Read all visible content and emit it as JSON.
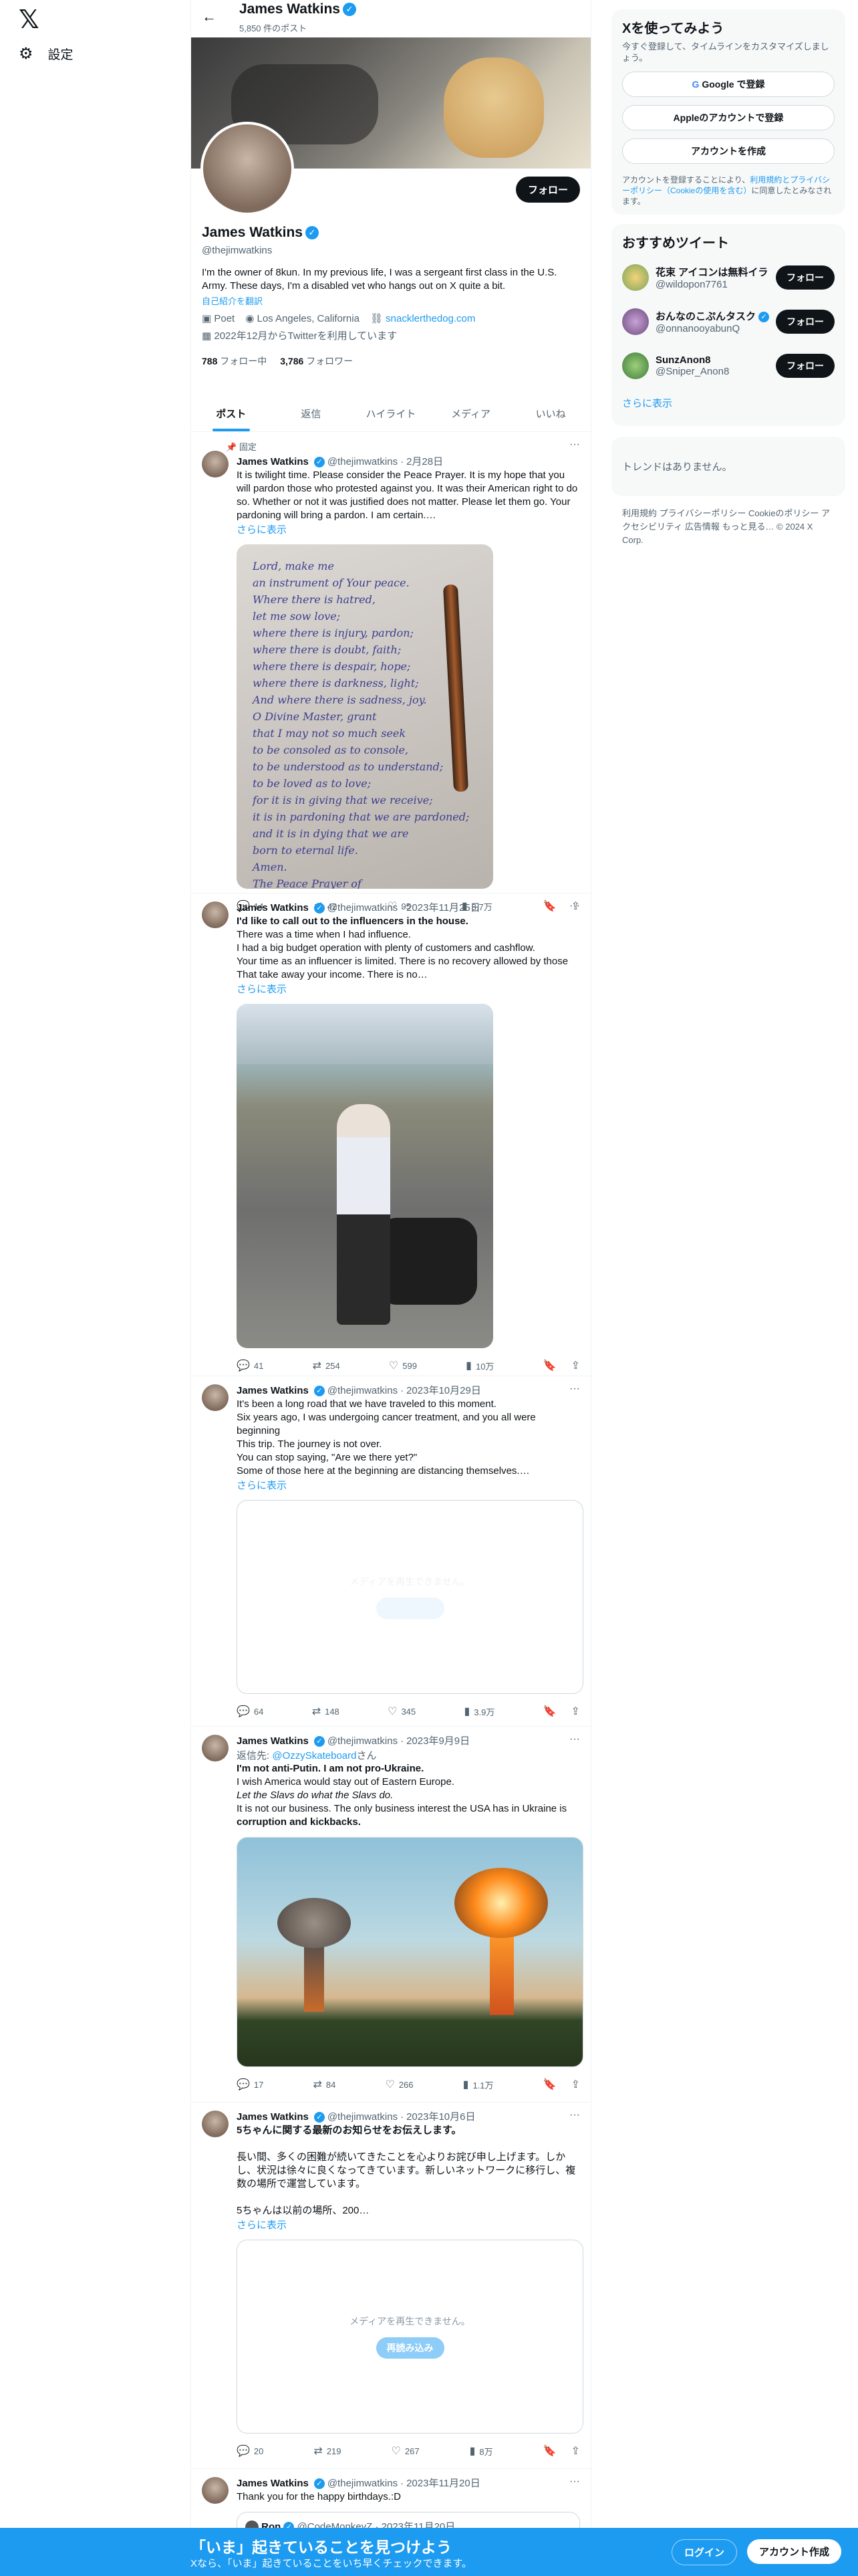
{
  "nav": {
    "logo": "𝕏",
    "settings_icon": "gear-icon",
    "settings_label": "設定"
  },
  "topbar": {
    "name": "James Watkins",
    "post_count": "5,850 件のポスト"
  },
  "profile": {
    "name": "James Watkins",
    "handle": "@thejimwatkins",
    "follow": "フォロー",
    "bio": "I'm the owner of 8kun. In my previous life, I was a sergeant first class in the U.S. Army. These days, I'm a disabled vet who hangs out on X quite a bit.",
    "translate": "自己紹介を翻訳",
    "job": "Poet",
    "location": "Los Angeles, California",
    "link": "snacklerthedog.com",
    "joined": "2022年12月からTwitterを利用しています",
    "following_count": "788",
    "following_label": "フォロー中",
    "followers_count": "3,786",
    "followers_label": "フォロワー"
  },
  "tabs": [
    "ポスト",
    "返信",
    "ハイライト",
    "メディア",
    "いいね"
  ],
  "tweets": [
    {
      "pinned": "固定",
      "name": "James Watkins",
      "handle": "@thejimwatkins",
      "date": "2月28日",
      "text": "It is twilight time. Please consider the Peace Prayer. It is my hope that you will pardon those who protested against you. It was their American right to do so. Whether or not it was justified does not matter. Please let them go. Your pardoning will bring a pardon. I am certain.…",
      "more": "さらに表示",
      "letter": "Lord, make me\n  an instrument of Your peace.\nWhere there is hatred,\n  let me sow love;\nwhere there is injury, pardon;\nwhere there is doubt, faith;\nwhere there is despair, hope;\nwhere there is darkness, light;\nAnd where there is sadness, joy.\nO Divine Master, grant\nthat I may not so much seek\n  to be consoled as to console,\nto be understood as to understand;\nto be loved as to love;\nfor it is in giving that we receive;\nit is in pardoning that we are pardoned;\nand it is in dying that we are\nborn to eternal life.\n  Amen.\n The Peace Prayer of\n St. Francis of Assisi",
      "replies": "14",
      "retweets": "42",
      "likes": "95",
      "views": "8.7万"
    },
    {
      "name": "James Watkins",
      "handle": "@thejimwatkins",
      "date": "2023年11月25日",
      "title": "I'd like to call out to the influencers in the house.",
      "text": "There was a time when I had influence.\nI had a big budget operation with plenty of customers and cashflow.\nYour time as an influencer is limited. There is no recovery allowed by those That take away your income. There is no…",
      "more": "さらに表示",
      "replies": "41",
      "retweets": "254",
      "likes": "599",
      "views": "10万"
    },
    {
      "name": "James Watkins",
      "handle": "@thejimwatkins",
      "date": "2023年10月29日",
      "text": "It's been a long road that we have traveled to this moment.\nSix years ago, I was undergoing cancer treatment, and you all were beginning\nThis trip. The journey is not over.\nYou can stop saying, \"Are we there yet?\"\nSome of those here at the beginning are distancing themselves.…",
      "more": "さらに表示",
      "media_msg": "メディアを再生できません。",
      "reload": "再読み込み",
      "replies": "64",
      "retweets": "148",
      "likes": "345",
      "views": "3.9万"
    },
    {
      "name": "James Watkins",
      "handle": "@thejimwatkins",
      "date": "2023年9月9日",
      "reply_prefix": "返信先: ",
      "reply_handle": "@OzzySkateboard",
      "reply_suffix": "さん",
      "title": "I'm not anti-Putin. I am not pro-Ukraine.",
      "line1": "I wish America would stay out of Eastern Europe.",
      "line2": "Let the Slavs do what the Slavs do.",
      "line3": "It is not our business. The only business interest the USA has in Ukraine is",
      "line4": "corruption and kickbacks.",
      "replies": "17",
      "retweets": "84",
      "likes": "266",
      "views": "1.1万"
    },
    {
      "name": "James Watkins",
      "handle": "@thejimwatkins",
      "date": "2023年10月6日",
      "title": "5ちゃんに関する最新のお知らせをお伝えします。",
      "text": "長い間、多くの困難が続いてきたことを心よりお詫び申し上げます。しかし、状況は徐々に良くなってきています。新しいネットワークに移行し、複数の場所で運営しています。\n\n5ちゃんは以前の場所、200…",
      "more": "さらに表示",
      "media_msg": "メディアを再生できません。",
      "reload": "再読み込み",
      "replies": "20",
      "retweets": "219",
      "likes": "267",
      "views": "8万"
    },
    {
      "name": "James Watkins",
      "handle": "@thejimwatkins",
      "date": "2023年11月20日",
      "text": "Thank you for the happy birthdays.:D",
      "quote_name": "Ron",
      "quote_handle": "@CodeMonkeyZ",
      "quote_date": "2023年11月20日"
    }
  ],
  "sidebar": {
    "signup_title": "Xを使ってみよう",
    "signup_sub": "今すぐ登録して、タイムラインをカスタマイズしましょう。",
    "google": "Google で登録",
    "apple": "Appleのアカウントで登録",
    "create": "アカウントを作成",
    "legal_a": "アカウントを登録することにより、",
    "legal_b": "利用規約とプライバシーポリシー（Cookieの使用を含む）",
    "legal_c": "に同意したとみなされます。",
    "recommend_title": "おすすめツイート",
    "users": [
      {
        "name": "花束 アイコンは無料イラ",
        "handle": "@wildopon7761",
        "follow": "フォロー"
      },
      {
        "name": "おんなのこぷんタスク",
        "handle": "@onnanooyabunQ",
        "follow": "フォロー"
      },
      {
        "name": "SunzAnon8",
        "handle": "@Sniper_Anon8",
        "follow": "フォロー"
      }
    ],
    "show_more": "さらに表示",
    "trends_empty": "トレンドはありません。",
    "footer": "利用規約  プライバシーポリシー  Cookieのポリシー  アクセシビリティ  広告情報  もっと見る…  © 2024 X Corp."
  },
  "bottom": {
    "title": "「いま」起きていることを見つけよう",
    "sub": "Xなら、「いま」起きていることをいち早くチェックできます。",
    "login": "ログイン",
    "signup": "アカウント作成"
  }
}
